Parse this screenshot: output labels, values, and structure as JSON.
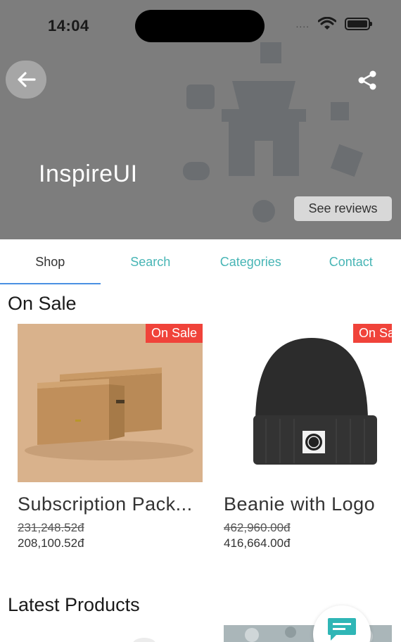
{
  "status_bar": {
    "time": "14:04",
    "signal_dots": "....",
    "wifi_icon": "wifi-icon",
    "battery_icon": "battery-icon"
  },
  "header": {
    "title": "InspireUI",
    "reviews_label": "See reviews",
    "back_icon": "arrow-left-icon",
    "share_icon": "share-icon"
  },
  "tabs": [
    {
      "label": "Shop",
      "active": true
    },
    {
      "label": "Search",
      "active": false
    },
    {
      "label": "Categories",
      "active": false
    },
    {
      "label": "Contact",
      "active": false
    }
  ],
  "on_sale": {
    "title": "On Sale",
    "products": [
      {
        "name": "Subscription Pack...",
        "badge": "On Sale",
        "old_price": "231,248.52đ",
        "new_price": "208,100.52đ"
      },
      {
        "name": "Beanie with Logo",
        "badge": "On Sa",
        "old_price": "462,960.00đ",
        "new_price": "416,664.00đ"
      }
    ]
  },
  "latest": {
    "title": "Latest Products"
  },
  "colors": {
    "accent": "#47b5b5",
    "sale": "#f0433a",
    "tab_indicator": "#4a90e2",
    "header_overlay": "#7d7d7d"
  }
}
